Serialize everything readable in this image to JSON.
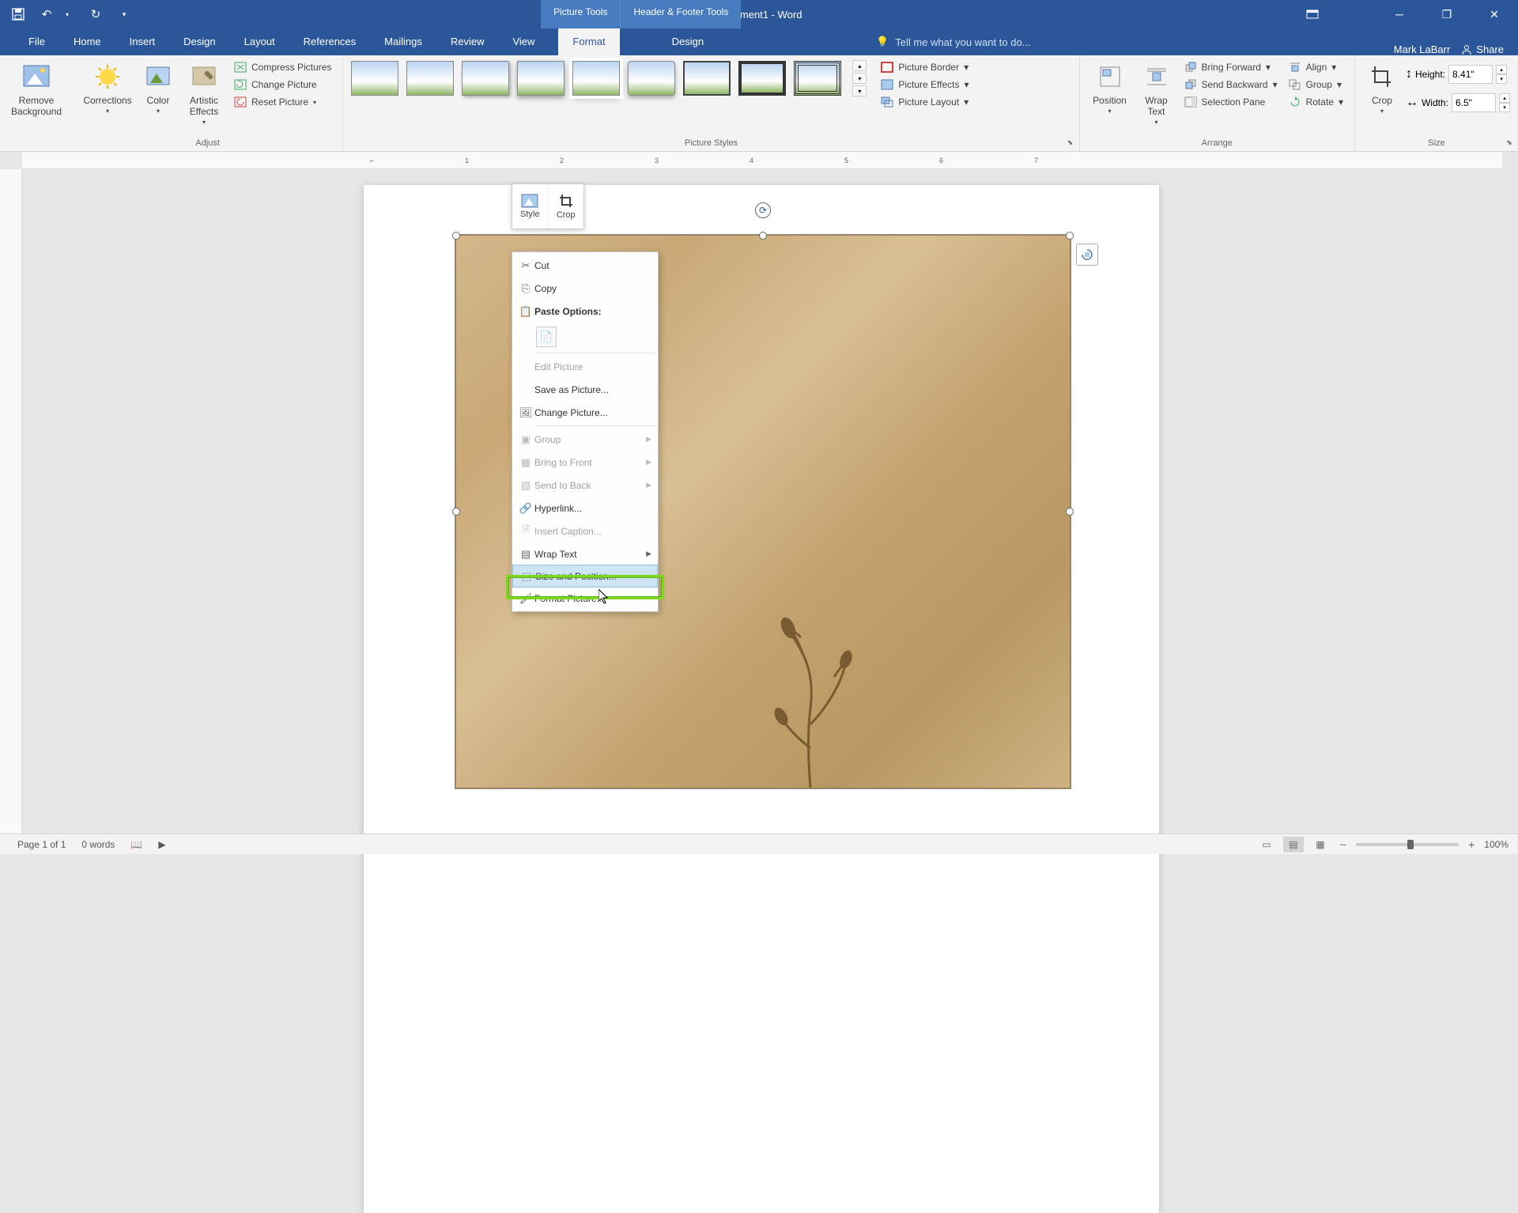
{
  "titlebar": {
    "doc_title": "Document1 - Word",
    "ctx_picture": "Picture Tools",
    "ctx_header": "Header & Footer Tools"
  },
  "tabs": {
    "file": "File",
    "home": "Home",
    "insert": "Insert",
    "design": "Design",
    "layout": "Layout",
    "references": "References",
    "mailings": "Mailings",
    "review": "Review",
    "view": "View",
    "format": "Format",
    "design2": "Design"
  },
  "tellme": {
    "placeholder": "Tell me what you want to do..."
  },
  "user": {
    "name": "Mark LaBarr",
    "share": "Share"
  },
  "ribbon": {
    "remove_bg": "Remove Background",
    "corrections": "Corrections",
    "color": "Color",
    "artistic": "Artistic Effects",
    "compress": "Compress Pictures",
    "change": "Change Picture",
    "reset": "Reset Picture",
    "adjust": "Adjust",
    "picture_styles": "Picture Styles",
    "border": "Picture Border",
    "effects": "Picture Effects",
    "layout": "Picture Layout",
    "position": "Position",
    "wrap": "Wrap Text",
    "bring_fwd": "Bring Forward",
    "send_bwd": "Send Backward",
    "sel_pane": "Selection Pane",
    "align": "Align",
    "group": "Group",
    "rotate": "Rotate",
    "arrange": "Arrange",
    "crop": "Crop",
    "height": "Height:",
    "width": "Width:",
    "height_val": "8.41\"",
    "width_val": "6.5\"",
    "size": "Size"
  },
  "mini": {
    "style": "Style",
    "crop": "Crop"
  },
  "ctx": {
    "cut": "Cut",
    "copy": "Copy",
    "paste": "Paste Options:",
    "edit": "Edit Picture",
    "saveas": "Save as Picture...",
    "change": "Change Picture...",
    "group": "Group",
    "bring": "Bring to Front",
    "send": "Send to Back",
    "hyperlink": "Hyperlink...",
    "caption": "Insert Caption...",
    "wrap": "Wrap Text",
    "size": "Size and Position...",
    "format": "Format Picture..."
  },
  "status": {
    "page": "Page 1 of 1",
    "words": "0 words",
    "zoom": "100%"
  },
  "ruler_numbers": [
    "1",
    "2",
    "3",
    "4",
    "5",
    "6",
    "7"
  ]
}
